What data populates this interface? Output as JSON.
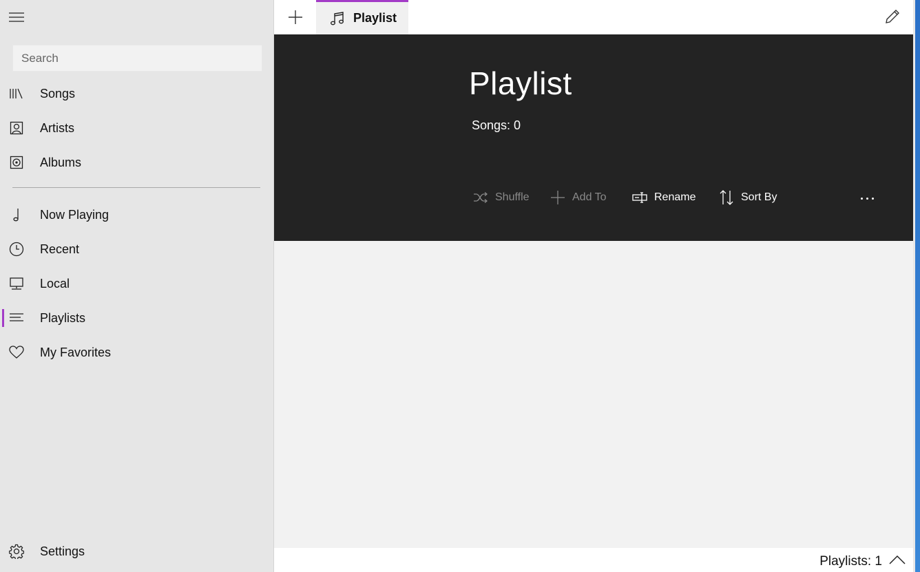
{
  "sidebar": {
    "search_placeholder": "Search",
    "items": [
      {
        "label": "Songs",
        "icon": "library-icon"
      },
      {
        "label": "Artists",
        "icon": "artist-icon"
      },
      {
        "label": "Albums",
        "icon": "album-icon"
      },
      {
        "label": "Now Playing",
        "icon": "music-note-icon"
      },
      {
        "label": "Recent",
        "icon": "clock-icon"
      },
      {
        "label": "Local",
        "icon": "computer-icon"
      },
      {
        "label": "Playlists",
        "icon": "playlist-icon",
        "active": true
      },
      {
        "label": "My Favorites",
        "icon": "heart-icon"
      }
    ],
    "settings_label": "Settings"
  },
  "tabs": [
    {
      "label": "Playlist",
      "icon": "music-notes-icon",
      "active": true
    }
  ],
  "header": {
    "title": "Playlist",
    "songs_count": "Songs: 0",
    "commands": [
      {
        "label": "Shuffle",
        "enabled": false
      },
      {
        "label": "Add To",
        "enabled": false
      },
      {
        "label": "Rename",
        "enabled": true
      },
      {
        "label": "Sort By",
        "enabled": true
      }
    ]
  },
  "footer": {
    "playlists_count": "Playlists: 1"
  },
  "colors": {
    "accent": "#a33bc7",
    "header_bg": "#232323",
    "sidebar_bg": "#e6e6e6",
    "content_bg": "#f2f2f2"
  }
}
